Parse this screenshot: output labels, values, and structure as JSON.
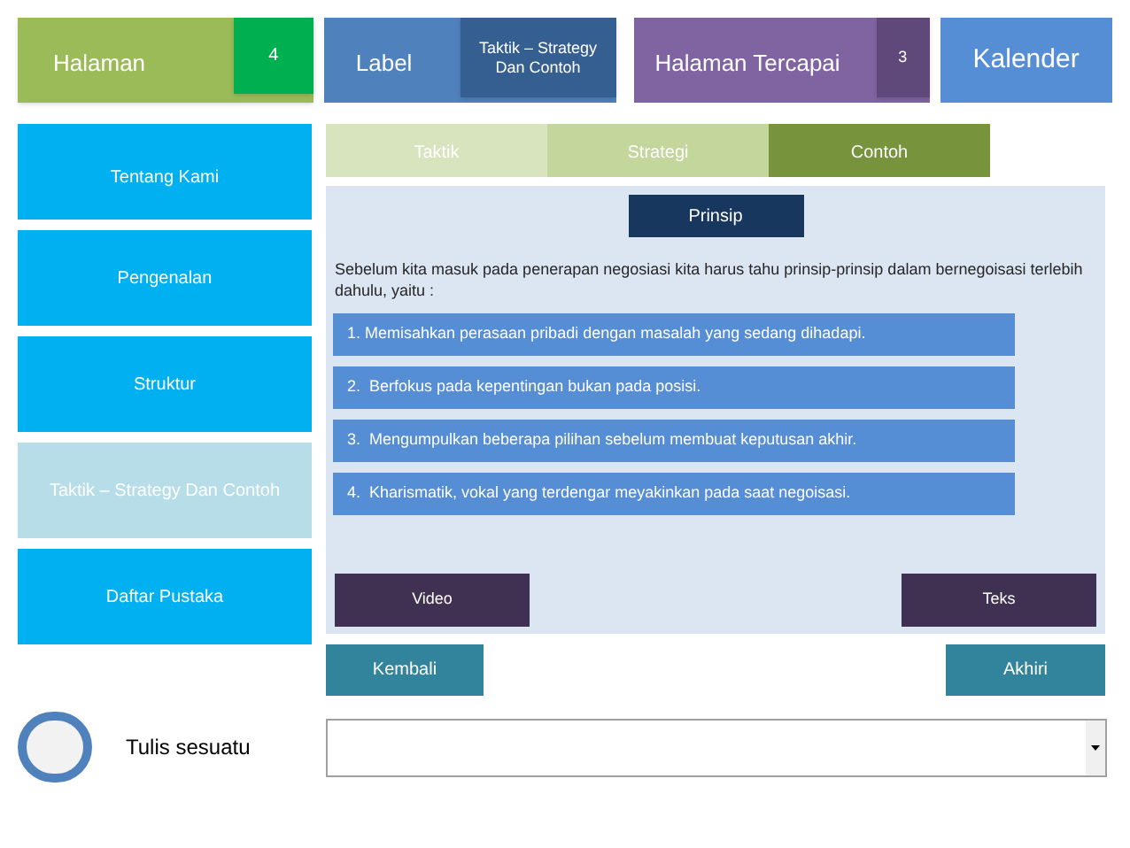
{
  "header": {
    "page_label": "Halaman",
    "page_count": "4",
    "label": "Label",
    "label_value": "Taktik – Strategy Dan Contoh",
    "reached_label": "Halaman Tercapai",
    "reached_count": "3",
    "calendar": "Kalender"
  },
  "sidebar": {
    "items": [
      {
        "label": "Tentang Kami",
        "selected": false
      },
      {
        "label": "Pengenalan",
        "selected": false
      },
      {
        "label": "Struktur",
        "selected": false
      },
      {
        "label": "Taktik – Strategy Dan Contoh",
        "selected": true
      },
      {
        "label": "Daftar Pustaka",
        "selected": false
      }
    ]
  },
  "tabs": [
    {
      "label": "Taktik",
      "selected": false
    },
    {
      "label": "Strategi",
      "selected": false
    },
    {
      "label": "Contoh",
      "selected": true
    }
  ],
  "content": {
    "heading": "Prinsip",
    "intro": "Sebelum kita masuk pada penerapan negosiasi kita harus tahu prinsip-prinsip dalam bernegoisasi terlebih dahulu, yaitu :",
    "points": [
      "1. Memisahkan perasaan pribadi dengan masalah yang sedang dihadapi.",
      "2.  Berfokus pada kepentingan bukan pada posisi.",
      "3.  Mengumpulkan beberapa pilihan sebelum membuat keputusan akhir.",
      "4.  Kharismatik, vokal yang terdengar meyakinkan pada saat negoisasi."
    ],
    "buttons": [
      "Video",
      "Teks"
    ]
  },
  "nav": {
    "back": "Kembali",
    "finish": "Akhiri"
  },
  "input": {
    "label": "Tulis sesuatu"
  }
}
